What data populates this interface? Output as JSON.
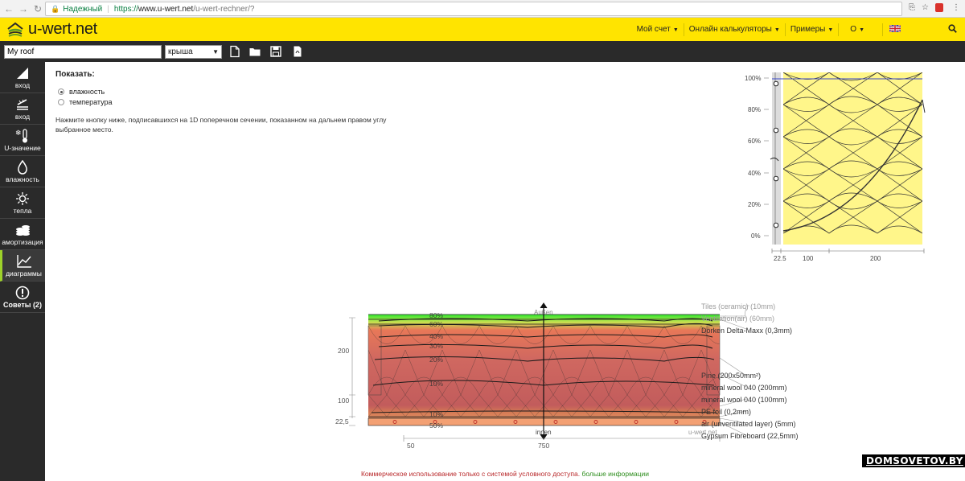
{
  "browser": {
    "secure_label": "Надежный",
    "url_proto": "https://",
    "url_host": "www.u-wert.net",
    "url_path": "/u-wert-rechner/?"
  },
  "header": {
    "logo_text": "u-wert.net",
    "menu": [
      {
        "label": "Мой счет"
      },
      {
        "label": "Онлайн калькуляторы"
      },
      {
        "label": "Примеры"
      },
      {
        "label": "О"
      }
    ]
  },
  "toolbar": {
    "project_name": "My roof",
    "construction_type": "крыша"
  },
  "sidebar": {
    "items": [
      {
        "label": "вход",
        "icon": "roof-icon"
      },
      {
        "label": "вход",
        "icon": "layers-icon"
      },
      {
        "label": "U-значение",
        "icon": "thermometer-icon"
      },
      {
        "label": "влажность",
        "icon": "drop-icon"
      },
      {
        "label": "тепла",
        "icon": "sun-icon"
      },
      {
        "label": "амортизация",
        "icon": "coins-icon"
      },
      {
        "label": "диаграммы",
        "icon": "chart-icon",
        "active": true
      },
      {
        "label": "Советы (2)",
        "icon": "exclamation-icon"
      }
    ]
  },
  "main": {
    "show_title": "Показать:",
    "options": [
      {
        "label": "влажность",
        "selected": true
      },
      {
        "label": "температура",
        "selected": false
      }
    ],
    "hint": "Нажмите кнопку ниже, подписавшихся на 1D поперечном сечении, показанном на дальнем правом углу выбранное место."
  },
  "profile_chart": {
    "y_ticks": [
      "100%",
      "80%",
      "60%",
      "40%",
      "20%",
      "0%"
    ],
    "x_ticks": [
      "22.5",
      "100",
      "200"
    ]
  },
  "section": {
    "outer_label": "Außen",
    "inner_label": "innen",
    "site_mark": "u-wert.net",
    "left_dims": [
      "200",
      "100",
      "22,5"
    ],
    "bottom_dims": [
      "50",
      "750"
    ],
    "contours": [
      "80%",
      "60%",
      "40%",
      "30%",
      "20%",
      "10%",
      "10%",
      "50%"
    ],
    "layers": [
      {
        "label": "Tiles (ceramic) (10mm)",
        "muted": true
      },
      {
        "label": "Ventilation(air) (60mm)",
        "muted": true
      },
      {
        "label": "Dörken Delta-Maxx (0,3mm)",
        "muted": false
      },
      {
        "label": "Pine (200x50mm²)",
        "muted": false
      },
      {
        "label": "mineral wool 040 (200mm)",
        "muted": false
      },
      {
        "label": "mineral wool 040 (100mm)",
        "muted": false
      },
      {
        "label": "PE foil (0,2mm)",
        "muted": false
      },
      {
        "label": "air (unventilated layer) (5mm)",
        "muted": false
      },
      {
        "label": "Gypsum Fibreboard (22,5mm)",
        "muted": false
      }
    ]
  },
  "footer": {
    "text": "Коммерческое использование только с системой условного доступа.",
    "link": "больше информации"
  },
  "watermark": "DOMSOVETOV.BY",
  "colors": {
    "header_bg": "#ffe400",
    "sidebar_bg": "#2a2a2a",
    "insulation": "#fff68a",
    "humid_red": "#c9605a",
    "dry_green": "#2ee82e"
  }
}
